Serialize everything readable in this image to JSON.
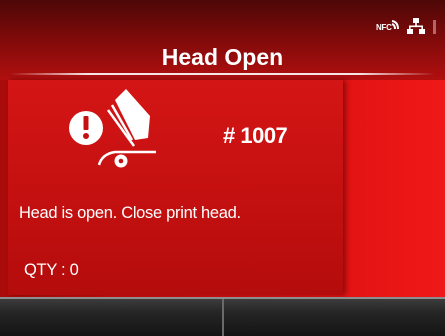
{
  "header": {
    "title": "Head Open",
    "status_icons": [
      "nfc-icon",
      "network-icon",
      "signal-icon"
    ],
    "nfc_label": "NFC"
  },
  "main": {
    "warning_icon": "head-open-warning-icon",
    "job_number": "# 1007",
    "message": "Head is open. Close print head.",
    "qty_text": "QTY : 0"
  },
  "softkeys": {
    "left_label": "",
    "right_label": ""
  },
  "colors": {
    "background_red": "#d91212",
    "text": "#ffffff",
    "softkey_bar": "#1c1c1c"
  }
}
